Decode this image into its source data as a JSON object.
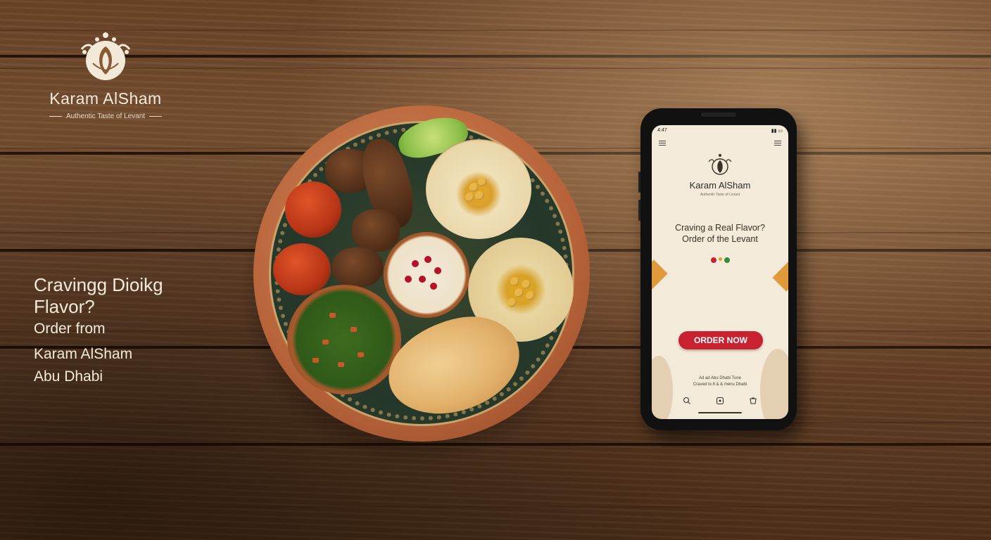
{
  "brand": {
    "name": "Karam AlSham",
    "tagline": "Authentic Taste of Levant"
  },
  "headline": {
    "line1": "Cravingg Dioikg",
    "line2": "Flavor?",
    "line3": "Order from",
    "line4": "Karam AlSham",
    "line5": "Abu Dhabi"
  },
  "phone": {
    "status_time": "4:47",
    "app_name": "Karam AlSham",
    "app_tagline": "Authentic Taste of Levant",
    "headline_line1": "Craving a Real Flavor?",
    "headline_line2": "Order of the Levant",
    "order_button": "ORDER NOW",
    "footer_line1": "Ad ad Abu Dhabi Tune",
    "footer_line2": "Craved to 8 & & menu Dhabi",
    "nav_icons": [
      "search-icon",
      "home-icon",
      "cart-icon"
    ],
    "dot_colors": [
      "#c82230",
      "#e0a020",
      "#2f8a3a"
    ],
    "accent_color": "#c82230"
  }
}
